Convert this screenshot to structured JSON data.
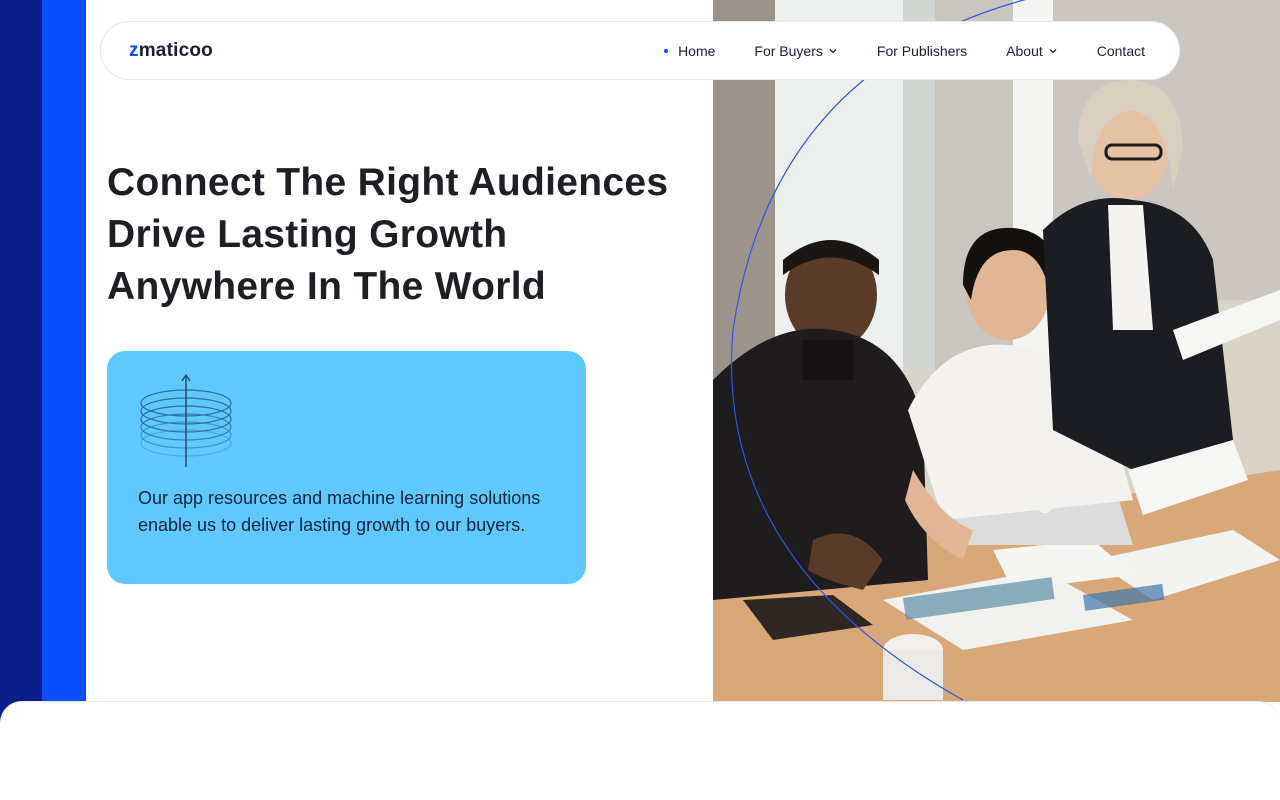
{
  "brand": {
    "name": "zmaticoo",
    "accent": "#0b4dff",
    "dark": "#0a1f8c",
    "card_bg": "#5ec9fd"
  },
  "nav": {
    "items": [
      {
        "label": "Home",
        "active": true
      },
      {
        "label": "For Buyers",
        "has_dropdown": true
      },
      {
        "label": "For Publishers"
      },
      {
        "label": "About",
        "has_dropdown": true
      },
      {
        "label": "Contact"
      }
    ]
  },
  "hero": {
    "headline_lines": [
      "Connect The Right Audiences",
      "Drive Lasting Growth",
      "Anywhere In The World"
    ],
    "card": {
      "icon": "stacked-rings-arrow-icon",
      "text": "Our app resources and machine learning solutions enable us to deliver lasting growth to our buyers."
    }
  }
}
